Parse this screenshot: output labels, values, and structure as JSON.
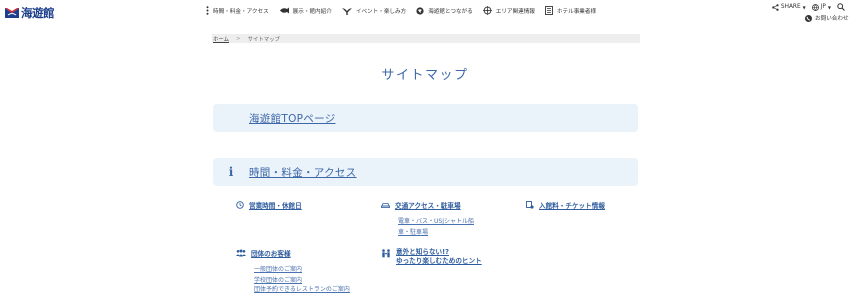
{
  "header": {
    "logo_text": "海遊館",
    "nav": [
      {
        "label": "時間・料金・アクセス",
        "icon": "menu-dots-icon"
      },
      {
        "label": "展示・館内紹介",
        "icon": "fish-icon"
      },
      {
        "label": "イベント・楽しみ方",
        "icon": "bird-icon"
      },
      {
        "label": "海遊館とつながる",
        "icon": "globe-icon"
      },
      {
        "label": "エリア関連情報",
        "icon": "compass-icon"
      },
      {
        "label": "ホテル事業者様",
        "icon": "building-icon"
      }
    ],
    "share_label": "SHARE",
    "language_label": "JP",
    "contact_label": "お問い合わせ"
  },
  "breadcrumb": {
    "home": "ホーム",
    "separator": ">",
    "current": "サイトマップ"
  },
  "page_title": "サイトマップ",
  "sections": {
    "top_link": "海遊館TOPページ",
    "access": {
      "icon_char": "i",
      "label": "時間・料金・アクセス",
      "hours": {
        "label": "営業時間・休館日"
      },
      "transport": {
        "label": "交通アクセス・駐車場",
        "links": [
          "電車・バス・USJシャトル船",
          "車・駐車場"
        ]
      },
      "tickets": {
        "label": "入館料・チケット情報"
      },
      "groups": {
        "label": "団体のお客様",
        "links": [
          "一般団体のご案内",
          "学校団体のご案内",
          "団体予約できるレストランのご案内"
        ]
      },
      "tips": {
        "label_line1": "意外と知らない!?",
        "label_line2": "ゆったり楽しむためのヒント"
      }
    }
  },
  "colors": {
    "accent": "#3d67a8",
    "bar_bg": "#eaf2fa",
    "breadcrumb_bg": "#eeeeee",
    "logo_red": "#d7282f",
    "logo_blue": "#1d3f8c"
  }
}
